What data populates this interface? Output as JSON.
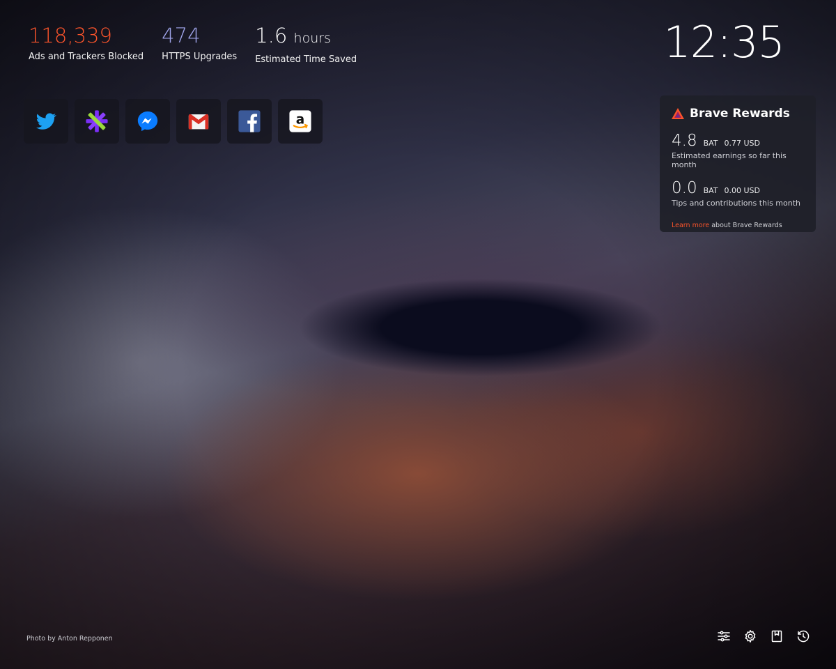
{
  "stats": [
    {
      "value": "118,339",
      "unit": "",
      "label": "Ads and Trackers Blocked",
      "color": "#fb542b"
    },
    {
      "value": "474",
      "unit": "",
      "label": "HTTPS Upgrades",
      "color": "#a0a5eb"
    },
    {
      "value": "1.6",
      "unit": "hours",
      "label": "Estimated Time Saved",
      "color": "#ffffff"
    }
  ],
  "clock": {
    "time": "12:35"
  },
  "top_sites": [
    {
      "name": "Twitter",
      "icon": "twitter-icon"
    },
    {
      "name": "E*TRADE",
      "icon": "etrade-icon"
    },
    {
      "name": "Messenger",
      "icon": "messenger-icon"
    },
    {
      "name": "Gmail",
      "icon": "gmail-icon"
    },
    {
      "name": "Facebook",
      "icon": "facebook-icon"
    },
    {
      "name": "Amazon",
      "icon": "amazon-icon"
    }
  ],
  "rewards": {
    "title": "Brave Rewards",
    "earnings": {
      "amount": "4.8",
      "currency": "BAT",
      "usd": "0.77 USD",
      "description": "Estimated earnings so far this month"
    },
    "tips": {
      "amount": "0.0",
      "currency": "BAT",
      "usd": "0.00 USD",
      "description": "Tips and contributions this month"
    },
    "learn_more_link": "Learn more",
    "learn_more_text": "about Brave Rewards"
  },
  "photo_credit": "Photo by Anton Repponen",
  "bottom_controls": [
    {
      "icon": "customize-icon"
    },
    {
      "icon": "settings-icon"
    },
    {
      "icon": "bookmarks-icon"
    },
    {
      "icon": "history-icon"
    }
  ],
  "colors": {
    "brand_orange": "#fb542b",
    "https_purple": "#a0a5eb",
    "card_bg": "#1e2028"
  }
}
